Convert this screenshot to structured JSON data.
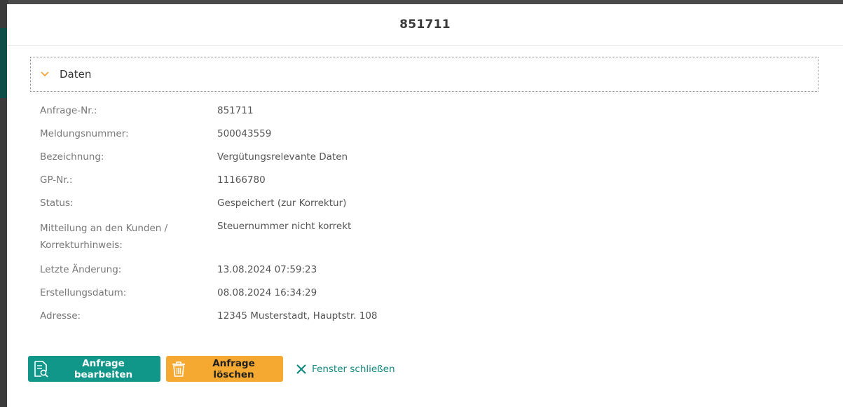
{
  "modal": {
    "title": "851711"
  },
  "accordion": {
    "label": "Daten",
    "icon": "chevron-down-icon",
    "accent": "#f0a030"
  },
  "fields": [
    {
      "label": "Anfrage-Nr.:",
      "value": "851711"
    },
    {
      "label": "Meldungsnummer:",
      "value": "500043559"
    },
    {
      "label": "Bezeichnung:",
      "value": "Vergütungsrelevante Daten"
    },
    {
      "label": "GP-Nr.:",
      "value": "11166780"
    },
    {
      "label": "Status:",
      "value": "Gespeichert (zur Korrektur)"
    },
    {
      "label": "Mitteilung an den Kunden / Korrekturhinweis:",
      "value": "Steuernummer nicht korrekt"
    },
    {
      "label": "Letzte Änderung:",
      "value": "13.08.2024 07:59:23"
    },
    {
      "label": "Erstellungsdatum:",
      "value": "08.08.2024 16:34:29"
    },
    {
      "label": "Adresse:",
      "value": "12345 Musterstadt, Hauptstr. 108"
    }
  ],
  "actions": {
    "edit_label": "Anfrage bearbeiten",
    "edit_icon": "document-search-icon",
    "edit_color": "#11968a",
    "delete_label": "Anfrage löschen",
    "delete_icon": "trash-icon",
    "delete_color": "#f6a930",
    "close_label": "Fenster schließen",
    "close_icon": "close-icon",
    "close_color": "#10897e"
  }
}
